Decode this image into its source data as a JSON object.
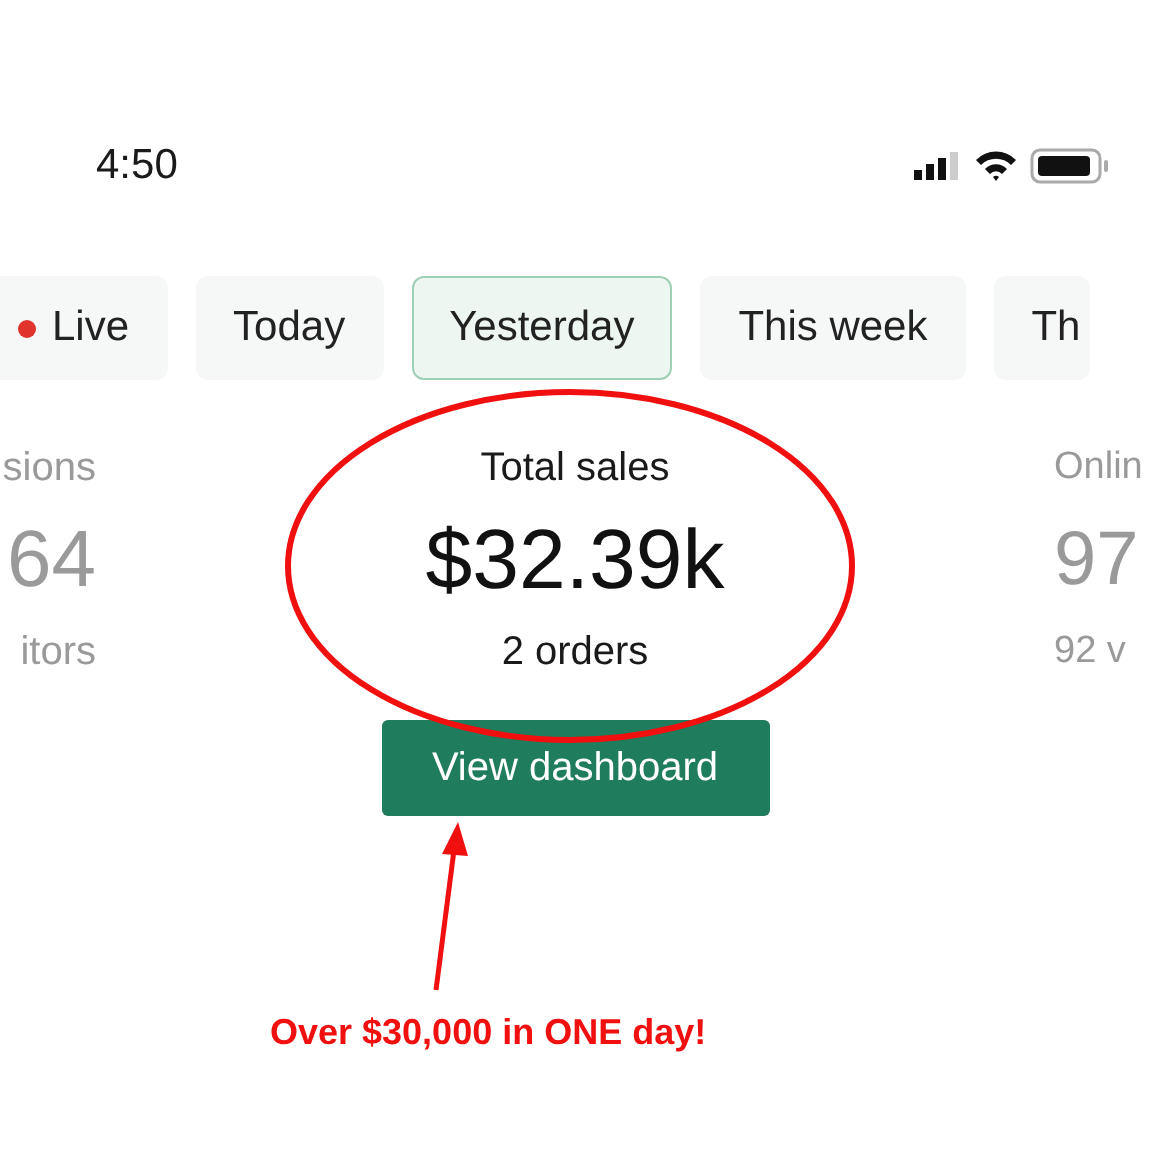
{
  "status_bar": {
    "time": "4:50"
  },
  "tabs": [
    {
      "label": "Live",
      "kind": "live",
      "selected": false
    },
    {
      "label": "Today",
      "kind": "plain",
      "selected": false
    },
    {
      "label": "Yesterday",
      "kind": "plain",
      "selected": true
    },
    {
      "label": "This week",
      "kind": "plain",
      "selected": false
    },
    {
      "label": "Th",
      "kind": "plain",
      "selected": false
    }
  ],
  "metrics": [
    {
      "kind": "left",
      "label": "sions",
      "value": "64",
      "sub": "itors"
    },
    {
      "kind": "main",
      "label": "Total sales",
      "value": "$32.39k",
      "sub": "2 orders"
    },
    {
      "kind": "right",
      "label": "Onlin",
      "value": "97",
      "sub": "92 v"
    }
  ],
  "button": "View dashboard",
  "annotation": {
    "text": "Over $30,000 in ONE day!"
  }
}
